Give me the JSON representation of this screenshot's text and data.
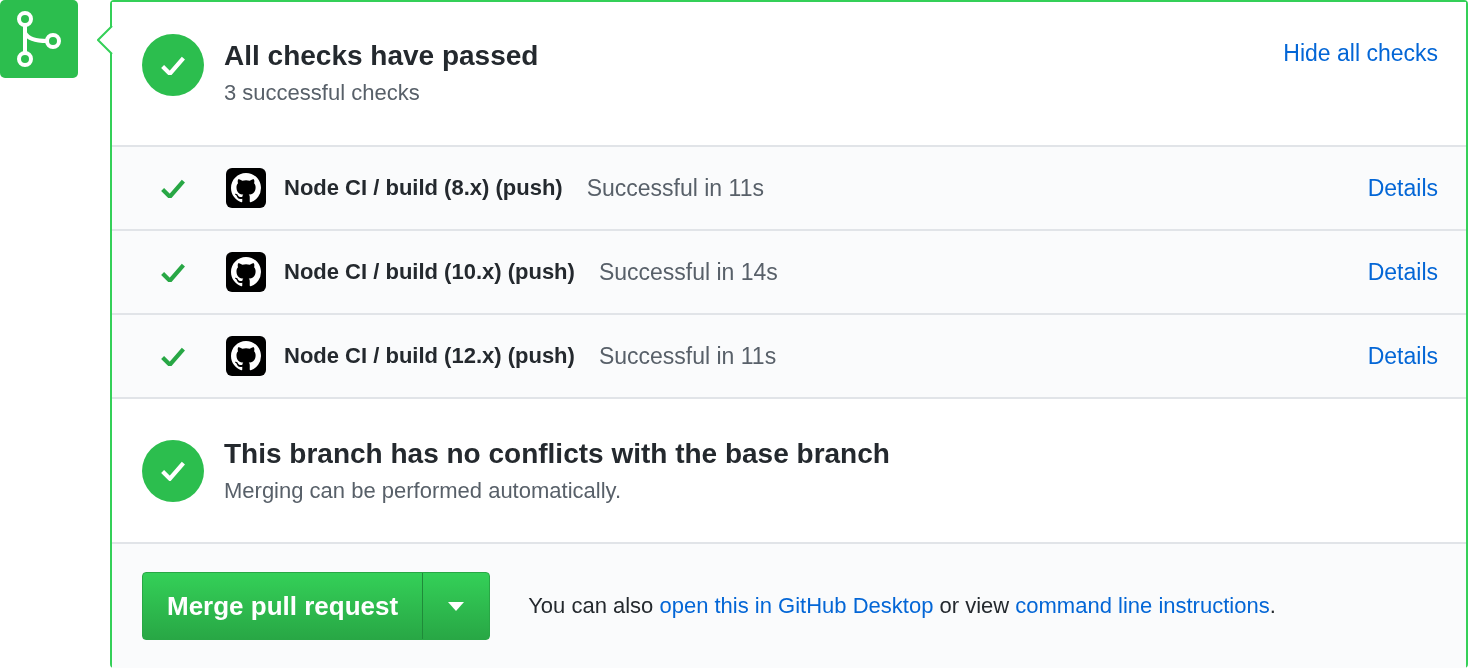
{
  "summary": {
    "passed": true,
    "title": "All checks have passed",
    "subtitle": "3 successful checks",
    "toggle_link": "Hide all checks"
  },
  "checks": [
    {
      "passed": true,
      "name": "Node CI / build (8.x) (push)",
      "result": "Successful in 11s",
      "link": "Details"
    },
    {
      "passed": true,
      "name": "Node CI / build (10.x) (push)",
      "result": "Successful in 14s",
      "link": "Details"
    },
    {
      "passed": true,
      "name": "Node CI / build (12.x) (push)",
      "result": "Successful in 11s",
      "link": "Details"
    }
  ],
  "branch_status": {
    "passed": true,
    "title": "This branch has no conflicts with the base branch",
    "subtitle": "Merging can be performed automatically."
  },
  "merge": {
    "button": "Merge pull request",
    "note": [
      {
        "kind": "text",
        "text": "You can also "
      },
      {
        "kind": "link",
        "text": "open this in GitHub Desktop"
      },
      {
        "kind": "text",
        "text": " or view "
      },
      {
        "kind": "link",
        "text": "command line instructions"
      },
      {
        "kind": "text",
        "text": "."
      }
    ]
  }
}
